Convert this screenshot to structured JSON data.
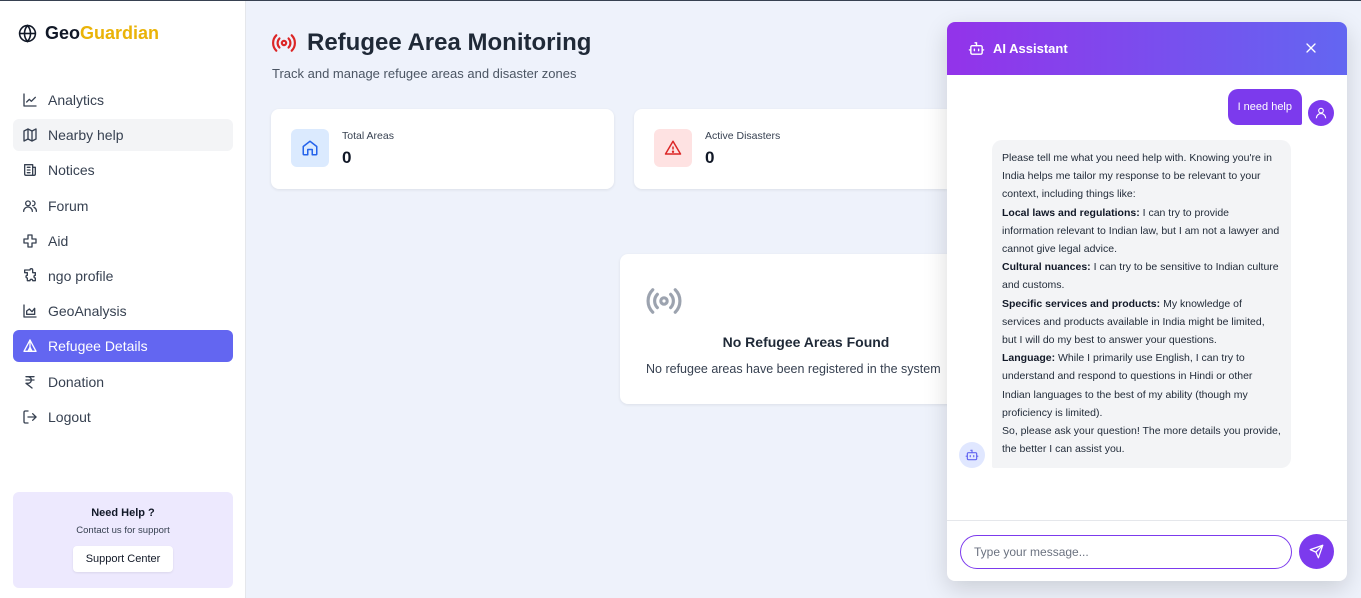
{
  "app": {
    "name_base": "Geo",
    "name_accent": "Guardian"
  },
  "sidebar": {
    "items": [
      {
        "label": "Analytics",
        "icon": "chart-line-icon"
      },
      {
        "label": "Nearby help",
        "icon": "map-icon"
      },
      {
        "label": "Notices",
        "icon": "newspaper-icon"
      },
      {
        "label": "Forum",
        "icon": "users-icon"
      },
      {
        "label": "Aid",
        "icon": "cross-icon"
      },
      {
        "label": "ngo profile",
        "icon": "puzzle-icon"
      },
      {
        "label": "GeoAnalysis",
        "icon": "area-chart-icon"
      },
      {
        "label": "Refugee Details",
        "icon": "tent-icon"
      },
      {
        "label": "Donation",
        "icon": "rupee-icon"
      },
      {
        "label": "Logout",
        "icon": "logout-icon"
      }
    ],
    "active_index": 7,
    "hover_index": 1,
    "help": {
      "title": "Need Help ?",
      "subtitle": "Contact us for support",
      "button": "Support Center"
    }
  },
  "main": {
    "title": "Refugee Area Monitoring",
    "subtitle": "Track and manage refugee areas and disaster zones",
    "stats": [
      {
        "label": "Total Areas",
        "value": "0",
        "icon": "home-icon"
      },
      {
        "label": "Active Disasters",
        "value": "0",
        "icon": "warning-icon"
      }
    ],
    "empty": {
      "title": "No Refugee Areas Found",
      "subtitle": "No refugee areas have been registered in the system"
    }
  },
  "chat": {
    "title": "AI Assistant",
    "user_message": "I need help",
    "bot_message": [
      {
        "text": "Please tell me what you need help with. Knowing you're in India helps me tailor my response to be relevant to your context, including things like:"
      },
      {
        "bold": "Local laws and regulations:",
        "text": " I can try to provide information relevant to Indian law, but I am not a lawyer and cannot give legal advice."
      },
      {
        "bold": "Cultural nuances:",
        "text": " I can try to be sensitive to Indian culture and customs."
      },
      {
        "bold": "Specific services and products:",
        "text": " My knowledge of services and products available in India might be limited, but I will do my best to answer your questions."
      },
      {
        "bold": "Language:",
        "text": " While I primarily use English, I can try to understand and respond to questions in Hindi or other Indian languages to the best of my ability (though my proficiency is limited)."
      },
      {
        "text": "So, please ask your question! The more details you provide, the better I can assist you."
      }
    ],
    "input_placeholder": "Type your message...",
    "input_value": ""
  },
  "colors": {
    "accent": "#6366f1",
    "purple": "#7c3aed",
    "logo_accent": "#eab308",
    "danger": "#dc2626"
  }
}
